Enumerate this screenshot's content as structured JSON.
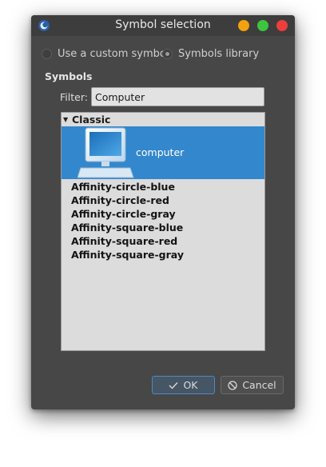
{
  "window": {
    "title": "Symbol selection"
  },
  "source_options": [
    {
      "label": "Use a custom symbol",
      "checked": false
    },
    {
      "label": "Symbols library",
      "checked": true
    }
  ],
  "symbols_section": {
    "label": "Symbols"
  },
  "filter": {
    "label": "Filter:",
    "value": "Computer"
  },
  "list": {
    "group": "Classic",
    "selected_item": "computer",
    "items": [
      "Affinity-circle-blue",
      "Affinity-circle-red",
      "Affinity-circle-gray",
      "Affinity-square-blue",
      "Affinity-square-red",
      "Affinity-square-gray"
    ]
  },
  "buttons": {
    "ok": "OK",
    "cancel": "Cancel"
  },
  "colors": {
    "selection": "#3387cc",
    "close": "#ee3d3d",
    "maximize": "#3ec43e",
    "minimize": "#f3a20f"
  },
  "icons": {
    "app": "app-logo-icon",
    "collapse": "collapse-arrow-icon",
    "ok": "checkmark-icon",
    "cancel": "cancel-circle-icon",
    "symbol": "computer-icon"
  }
}
